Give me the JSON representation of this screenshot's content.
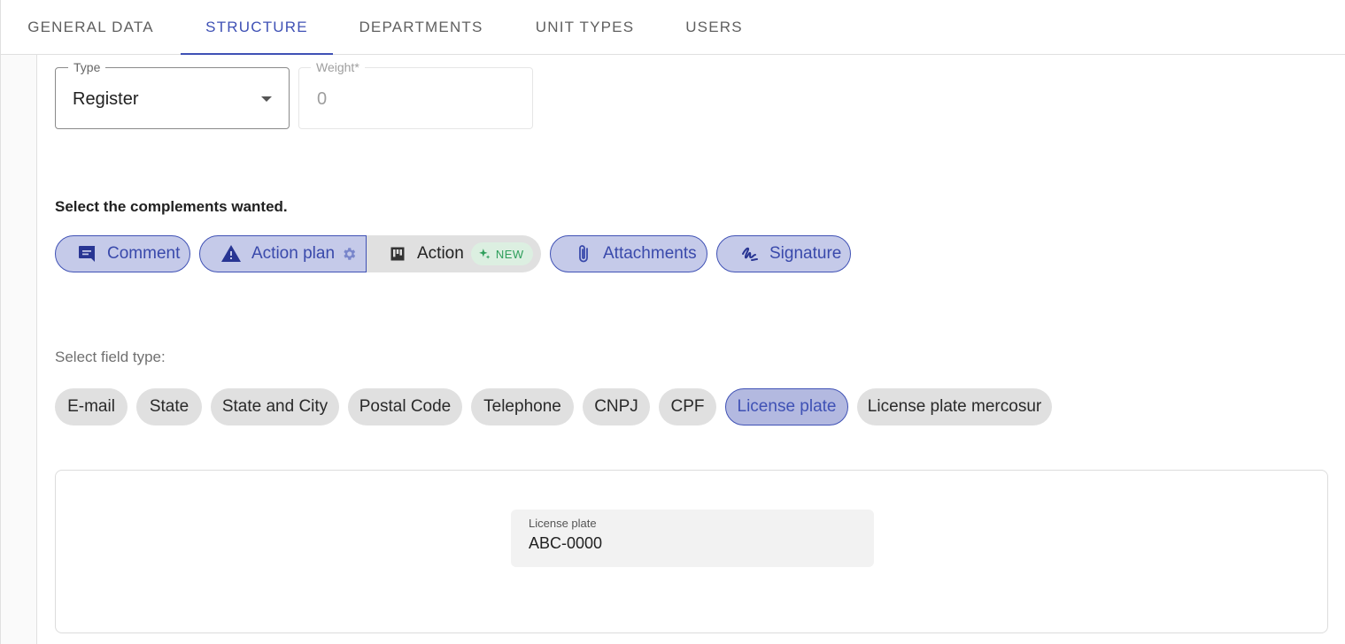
{
  "tabs": [
    {
      "label": "GENERAL DATA",
      "active": false
    },
    {
      "label": "STRUCTURE",
      "active": true
    },
    {
      "label": "DEPARTMENTS",
      "active": false
    },
    {
      "label": "UNIT TYPES",
      "active": false
    },
    {
      "label": "USERS",
      "active": false
    }
  ],
  "type_select": {
    "label": "Type",
    "value": "Register"
  },
  "weight_field": {
    "label": "Weight*",
    "value": "0"
  },
  "complements": {
    "title": "Select the complements wanted.",
    "comment": {
      "label": "Comment",
      "icon": "comment-icon"
    },
    "action_plan": {
      "label": "Action plan",
      "icon": "warning-icon",
      "settings_icon": "gear-icon"
    },
    "action": {
      "label": "Action",
      "icon": "kanban-icon",
      "badge": "NEW",
      "badge_icon": "sparkle-icon"
    },
    "attachments": {
      "label": "Attachments",
      "icon": "paperclip-icon"
    },
    "signature": {
      "label": "Signature",
      "icon": "signature-icon"
    }
  },
  "field_types": {
    "title": "Select field type:",
    "items": [
      "E-mail",
      "State",
      "State and City",
      "Postal Code",
      "Telephone",
      "CNPJ",
      "CPF",
      "License plate",
      "License plate mercosur"
    ],
    "selected": "License plate"
  },
  "preview": {
    "label": "License plate",
    "value": "ABC-0000"
  },
  "colors": {
    "accent": "#3f51b5",
    "chip_selected_bg": "#c5cae9",
    "chip_bg": "#e0e0e0",
    "new_badge": "#2e9e5b"
  }
}
